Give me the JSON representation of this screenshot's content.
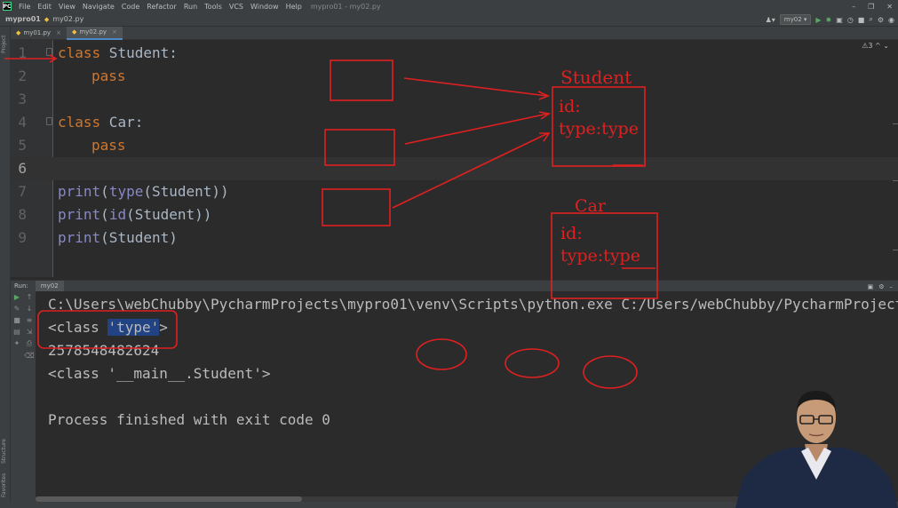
{
  "menubar": {
    "logo": "PC",
    "items": [
      "File",
      "Edit",
      "View",
      "Navigate",
      "Code",
      "Refactor",
      "Run",
      "Tools",
      "VCS",
      "Window",
      "Help"
    ],
    "window_title": "mypro01 - my02.py",
    "controls": [
      "–",
      "❐",
      "✕"
    ]
  },
  "navbar": {
    "project": "mypro01",
    "file": "my02.py",
    "run_config": "my02 ▾"
  },
  "left_strip": {
    "project_label": "Project",
    "structure_label": "Structure",
    "favorites_label": "Favorites"
  },
  "tabs": [
    {
      "label": "my01.py",
      "close": "×"
    },
    {
      "label": "my02.py",
      "close": "×"
    }
  ],
  "editor": {
    "inspections": "⚠3 ^ ⌄",
    "lines": [
      {
        "n": "1",
        "kw": "class",
        "rest": " Student:"
      },
      {
        "n": "2",
        "kw": "pass",
        "rest": ""
      },
      {
        "n": "3"
      },
      {
        "n": "4",
        "kw": "class",
        "rest": " Car:"
      },
      {
        "n": "5",
        "kw": "pass",
        "rest": ""
      },
      {
        "n": "6"
      },
      {
        "n": "7",
        "fn": "print",
        "t1": "(",
        "fn2": "type",
        "t2": "(Student))"
      },
      {
        "n": "8",
        "fn": "print",
        "t1": "(",
        "fn2": "id",
        "t2": "(Student))"
      },
      {
        "n": "9",
        "fn": "print",
        "t1": "(Student)"
      }
    ]
  },
  "run_panel": {
    "label": "Run:",
    "tab": "my02",
    "output": {
      "cmd": "C:\\Users\\webChubby\\PycharmProjects\\mypro01\\venv\\Scripts\\python.exe C:/Users/webChubby/PycharmProjects",
      "l2_pre": "<class ",
      "l2_sel": "'type'",
      "l2_post": ">",
      "l3": "2578548482624",
      "l4": "<class '__main__.Student'>",
      "l6": "Process finished with exit code 0"
    }
  },
  "annotations": {
    "student_title": "Student",
    "student_id": "id:",
    "student_type": "type:type",
    "car_title": "Car",
    "car_id": "id:",
    "car_type": "type:type",
    "color": "#e02020"
  }
}
